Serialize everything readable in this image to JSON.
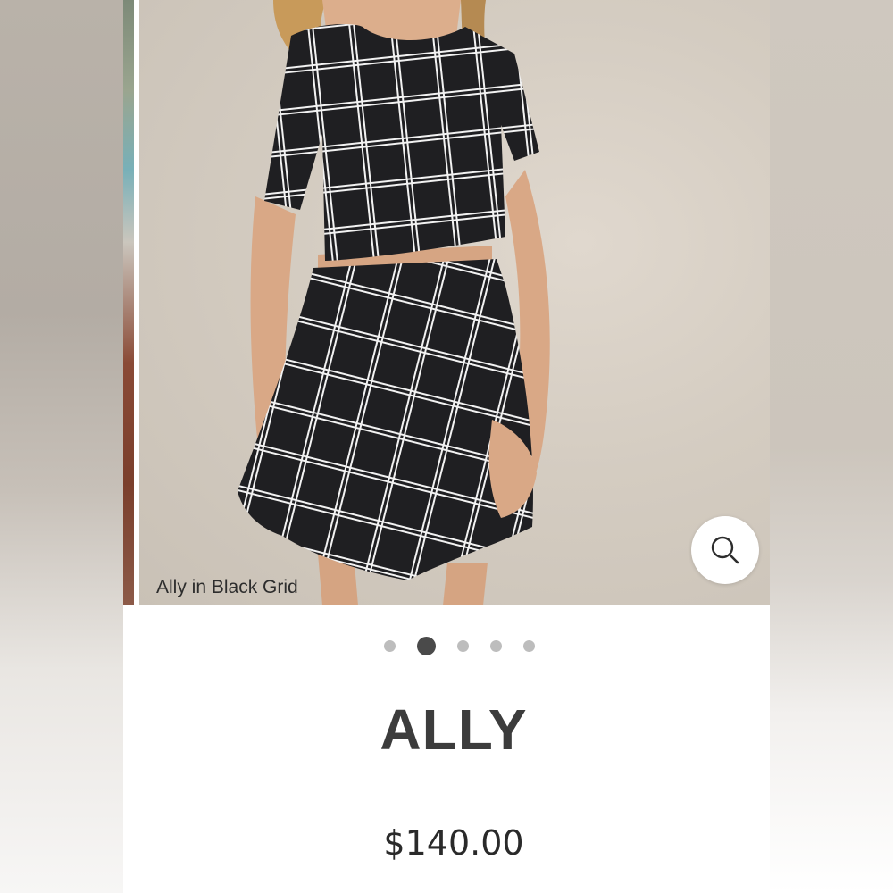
{
  "product": {
    "caption": "Ally in Black Grid",
    "name": "ALLY",
    "price": "$140.00"
  },
  "carousel": {
    "total_slides": 5,
    "active_index": 1
  },
  "icons": {
    "zoom": "search-icon"
  },
  "colors": {
    "title": "#3c3c3c",
    "dot_active": "#4a4a4a",
    "dot_inactive": "#bdbdbd",
    "garment": "#1f1f22",
    "grid_lines": "#ffffff"
  }
}
